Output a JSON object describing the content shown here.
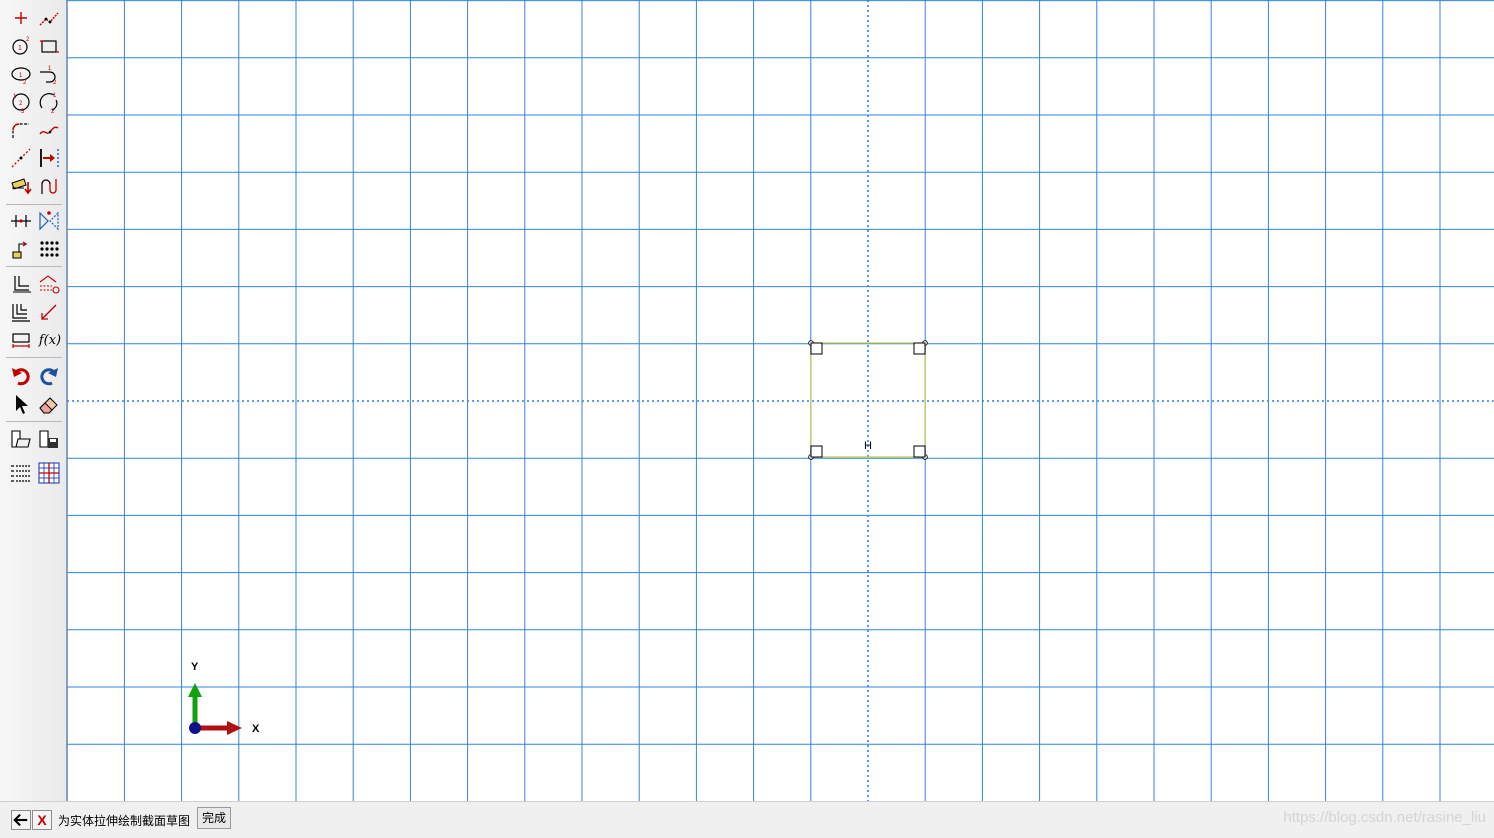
{
  "toolbox": {
    "tools": [
      {
        "name": "create-isolated-point-icon"
      },
      {
        "name": "create-lines-connected-icon"
      },
      {
        "name": "create-circle-center-perimeter-icon"
      },
      {
        "name": "create-lines-rectangle-icon"
      },
      {
        "name": "create-ellipse-icon"
      },
      {
        "name": "create-arc-tangent-icon"
      },
      {
        "name": "create-circle-3points-icon"
      },
      {
        "name": "create-arc-3points-icon"
      },
      {
        "name": "create-fillet-icon"
      },
      {
        "name": "create-spline-icon"
      },
      {
        "name": "create-construction-line-icon"
      },
      {
        "name": "add-constraint-icon"
      },
      {
        "name": "add-dimension-icon"
      },
      {
        "name": "edit-dimension-icon"
      },
      {
        "name": "split-icon"
      },
      {
        "name": "mirror-icon"
      },
      {
        "name": "move-icon"
      },
      {
        "name": "pattern-icon"
      },
      {
        "name": "offset-icon"
      },
      {
        "name": "auto-trim-icon"
      },
      {
        "name": "copy-icon"
      },
      {
        "name": "edit-parameter-icon"
      },
      {
        "name": "sketch-options-icon"
      },
      {
        "name": "function-icon"
      },
      {
        "name": "undo-icon"
      },
      {
        "name": "redo-icon"
      },
      {
        "name": "select-arrow-icon"
      },
      {
        "name": "eraser-icon"
      },
      {
        "name": "retrieve-sketch-icon"
      },
      {
        "name": "save-sketch-icon"
      },
      {
        "name": "parameter-manager-icon"
      },
      {
        "name": "grid-settings-icon"
      }
    ],
    "fx_label": "f(x)"
  },
  "viewport": {
    "grid_color": "#2f83e0",
    "construction_color": "#2f83e0",
    "geometry_color": "#c8c84a",
    "center_constraint_label": "H",
    "triad": {
      "x_label": "X",
      "y_label": "Y",
      "x_color": "#b01010",
      "y_color": "#10a010",
      "origin_color": "#10108a"
    }
  },
  "promptbar": {
    "back_icon": "back-arrow-icon",
    "cancel_label": "X",
    "prompt": "为实体拉伸绘制截面草图",
    "done_label": "完成"
  },
  "watermark": "https://blog.csdn.net/rasine_liu"
}
